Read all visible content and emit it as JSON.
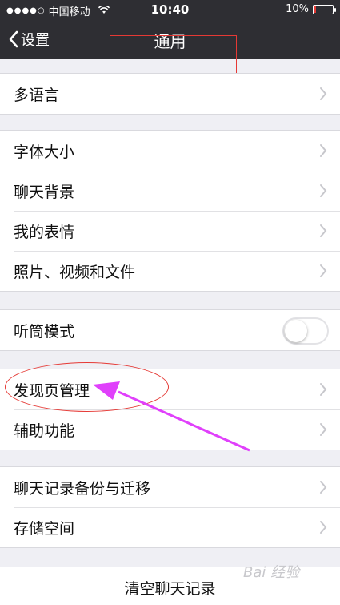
{
  "status_bar": {
    "signal_dots": "●●●●○",
    "carrier": "中国移动",
    "time": "10:40",
    "battery": "10%",
    "battery_level": 0.1
  },
  "nav": {
    "back_label": "设置",
    "title": "通用"
  },
  "groups": [
    {
      "items": [
        {
          "label": "多语言"
        }
      ]
    },
    {
      "items": [
        {
          "label": "字体大小"
        },
        {
          "label": "聊天背景"
        },
        {
          "label": "我的表情"
        },
        {
          "label": "照片、视频和文件"
        }
      ]
    },
    {
      "items": [
        {
          "label": "听筒模式",
          "toggle": false
        }
      ]
    },
    {
      "items": [
        {
          "label": "发现页管理"
        },
        {
          "label": "辅助功能"
        }
      ]
    },
    {
      "items": [
        {
          "label": "聊天记录备份与迁移"
        },
        {
          "label": "存储空间"
        }
      ]
    }
  ],
  "clear_chat": "清空聊天记录",
  "watermark": "Bai 经验",
  "colors": {
    "bar": "#2e2e33",
    "background": "#efeff4",
    "annotation": "#e53935",
    "arrow": "#e040fb"
  }
}
